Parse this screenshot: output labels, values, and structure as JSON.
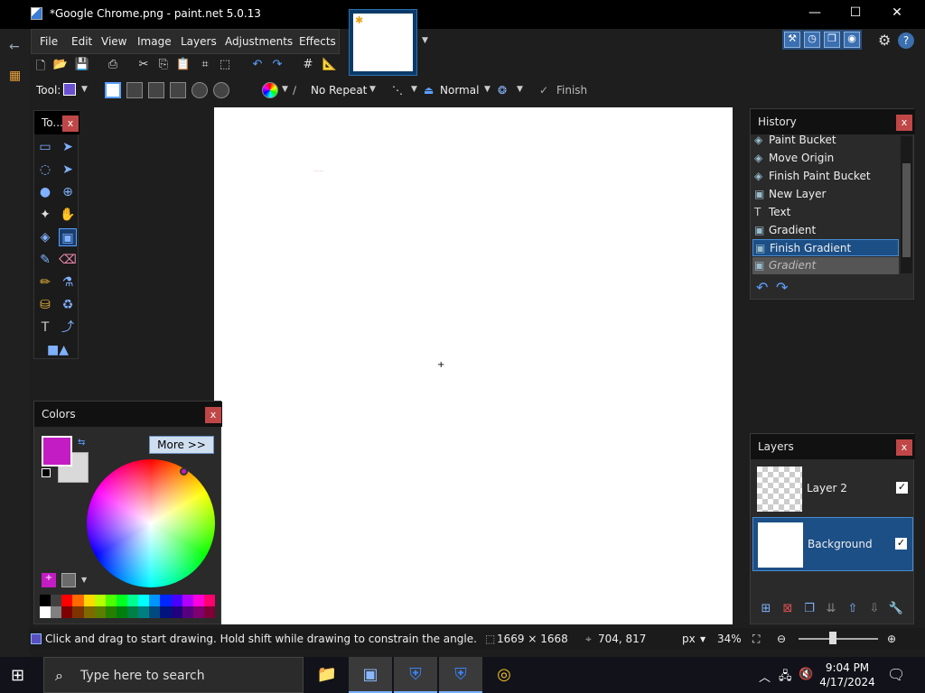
{
  "window": {
    "title": "*Google Chrome.png - paint.net 5.0.13",
    "minimize": "—",
    "maximize": "☐",
    "close": "✕"
  },
  "menu": [
    "File",
    "Edit",
    "View",
    "Image",
    "Layers",
    "Adjustments",
    "Effects"
  ],
  "toolbar2": {
    "tool_label": "Tool:",
    "repeat": "No Repeat",
    "blend": "Normal",
    "finish": "Finish"
  },
  "tools_panel": {
    "title": "To..."
  },
  "colors_panel": {
    "title": "Colors",
    "more": "More >>",
    "primary": "#c41cc4",
    "secondary": "#d9d9d9"
  },
  "history": {
    "title": "History",
    "items": [
      {
        "label": "Paint Bucket",
        "icon": "paint-bucket-icon",
        "state": "normal"
      },
      {
        "label": "Move Origin",
        "icon": "paint-bucket-icon",
        "state": "normal"
      },
      {
        "label": "Finish Paint Bucket",
        "icon": "paint-bucket-icon",
        "state": "normal"
      },
      {
        "label": "New Layer",
        "icon": "new-layer-icon",
        "state": "normal"
      },
      {
        "label": "Text",
        "icon": "text-icon",
        "state": "normal"
      },
      {
        "label": "Gradient",
        "icon": "gradient-icon",
        "state": "normal"
      },
      {
        "label": "Finish Gradient",
        "icon": "gradient-icon",
        "state": "selected"
      },
      {
        "label": "Gradient",
        "icon": "gradient-icon",
        "state": "undone"
      }
    ]
  },
  "layers": {
    "title": "Layers",
    "items": [
      {
        "name": "Layer 2",
        "visible": true
      },
      {
        "name": "Background",
        "visible": true
      }
    ]
  },
  "status": {
    "hint": "Click and drag to start drawing. Hold shift while drawing to constrain the angle.",
    "size": "1669 × 1668",
    "cursor": "704, 817",
    "units": "px",
    "zoom": "34%"
  },
  "taskbar": {
    "search_placeholder": "Type here to search",
    "time": "9:04 PM",
    "date": "4/17/2024"
  }
}
